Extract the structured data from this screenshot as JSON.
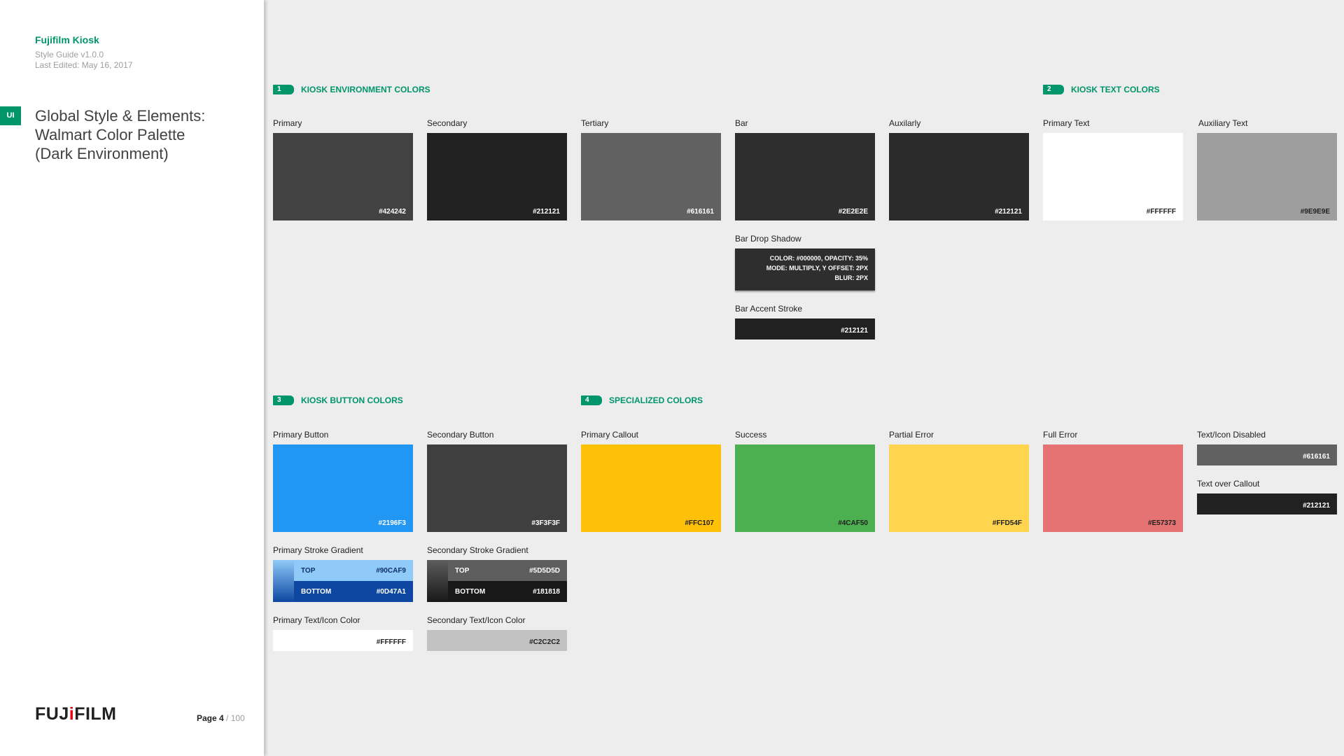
{
  "sidebar": {
    "brand_title": "Fujifilm Kiosk",
    "version": "Style Guide v1.0.0",
    "last_edited": "Last Edited: May 16, 2017",
    "ui_tag": "UI",
    "heading_lines": [
      "Global Style & Elements:",
      "Walmart Color Palette",
      "(Dark Environment)"
    ],
    "logo_left": "FUJ",
    "logo_accent": "i",
    "logo_right": "FILM",
    "page_label": "Page 4",
    "page_total": " / 100"
  },
  "sections": {
    "s1": {
      "num": "1",
      "title": "KIOSK ENVIRONMENT COLORS"
    },
    "s2": {
      "num": "2",
      "title": "KIOSK TEXT COLORS"
    },
    "s3": {
      "num": "3",
      "title": "KIOSK BUTTON COLORS"
    },
    "s4": {
      "num": "4",
      "title": "SPECIALIZED COLORS"
    }
  },
  "environment": {
    "primary": {
      "label": "Primary",
      "hex": "#424242"
    },
    "secondary": {
      "label": "Secondary",
      "hex": "#212121"
    },
    "tertiary": {
      "label": "Tertiary",
      "hex": "#616161"
    },
    "bar": {
      "label": "Bar",
      "hex": "#2E2E2E"
    },
    "auxiliary": {
      "label": "Auxilarly",
      "hex": "#212121"
    },
    "bar_drop_shadow": {
      "label": "Bar Drop Shadow",
      "lines": [
        "COLOR: #000000, OPACITY: 35%",
        "MODE: MULTIPLY, Y OFFSET: 2PX",
        "BLUR: 2PX"
      ]
    },
    "bar_accent_stroke": {
      "label": "Bar Accent Stroke",
      "hex": "#212121"
    }
  },
  "text_colors": {
    "primary_text": {
      "label": "Primary Text",
      "hex": "#FFFFFF"
    },
    "auxiliary_text": {
      "label": "Auxiliary Text",
      "hex": "#9E9E9E"
    }
  },
  "buttons": {
    "primary_button": {
      "label": "Primary Button",
      "hex": "#2196F3"
    },
    "secondary_button": {
      "label": "Secondary Button",
      "hex": "#3F3F3F"
    },
    "primary_stroke": {
      "label": "Primary Stroke Gradient",
      "top_label": "TOP",
      "top_hex": "#90CAF9",
      "bottom_label": "BOTTOM",
      "bottom_hex": "#0D47A1"
    },
    "secondary_stroke": {
      "label": "Secondary Stroke Gradient",
      "top_label": "TOP",
      "top_hex": "#5D5D5D",
      "bottom_label": "BOTTOM",
      "bottom_hex": "#181818"
    },
    "primary_text_icon": {
      "label": "Primary Text/Icon Color",
      "hex": "#FFFFFF"
    },
    "secondary_text_icon": {
      "label": "Secondary Text/Icon Color",
      "hex": "#C2C2C2"
    }
  },
  "specialized": {
    "primary_callout": {
      "label": "Primary Callout",
      "hex": "#FFC107"
    },
    "success": {
      "label": "Success",
      "hex": "#4CAF50"
    },
    "partial_error": {
      "label": "Partial Error",
      "hex": "#FFD54F"
    },
    "full_error": {
      "label": "Full Error",
      "hex": "#E57373"
    },
    "text_icon_disabled": {
      "label": "Text/Icon Disabled",
      "hex": "#616161"
    },
    "text_over_callout": {
      "label": "Text over Callout",
      "hex": "#212121"
    }
  }
}
